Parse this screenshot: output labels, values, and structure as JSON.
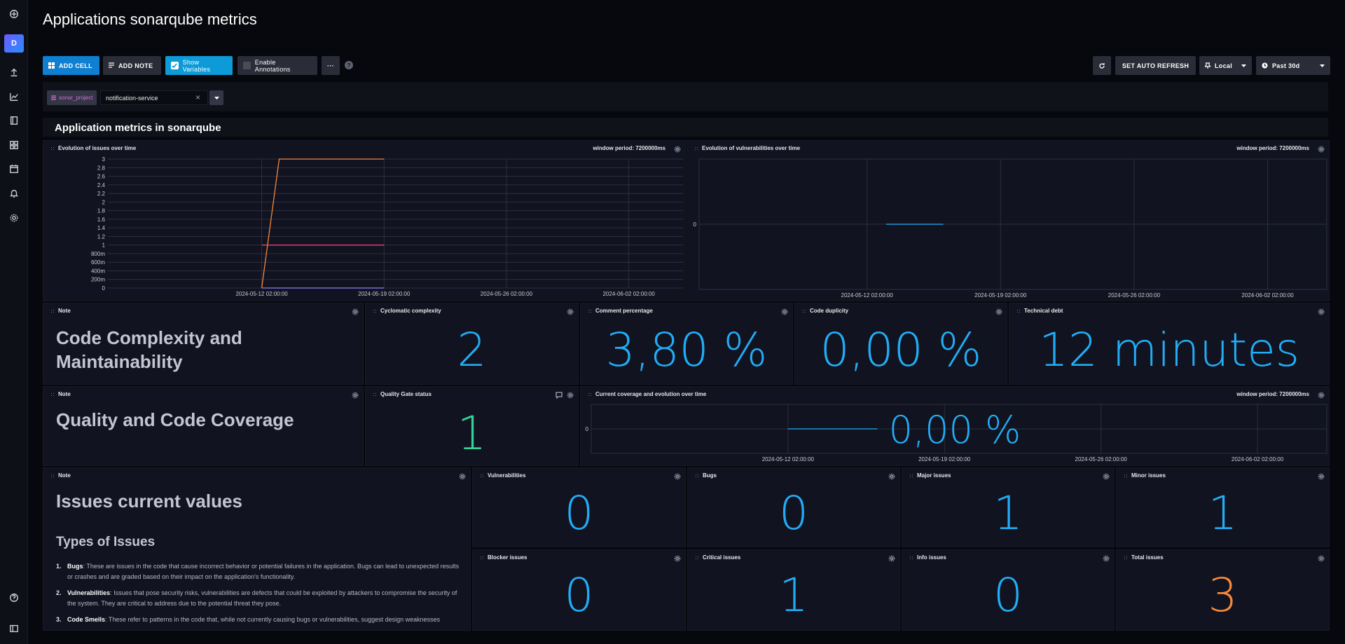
{
  "nav": {
    "avatar": "D",
    "icons": [
      "logo-icon",
      "upload-icon",
      "graph-icon",
      "notebook-icon",
      "dashboards-icon",
      "calendar-icon",
      "bell-icon",
      "gear-icon",
      "help-icon",
      "collapse-icon"
    ]
  },
  "page": {
    "title": "Applications sonarqube metrics"
  },
  "toolbar": {
    "add_cell": "ADD CELL",
    "add_note": "ADD NOTE",
    "show_variables": "Show Variables",
    "enable_annotations": "Enable Annotations",
    "more": "···",
    "help": "?",
    "refresh_icon": "refresh-icon",
    "auto_refresh": "SET AUTO REFRESH",
    "timezone": "Local",
    "time_range": "Past 30d"
  },
  "variables": {
    "name": "sonar_project",
    "value": "notification-service"
  },
  "section": {
    "title": "Application metrics in sonarqube"
  },
  "cells": {
    "issues_graph": {
      "title": "Evolution of issues over time",
      "window": "window period: 7200000ms"
    },
    "vuln_graph": {
      "title": "Evolution of vulnerabilities over time",
      "window": "window period: 7200000ms"
    },
    "note_complexity": {
      "title": "Note",
      "text_1": "Code Complexity and",
      "text_2": "Maintainability"
    },
    "cyclomatic": {
      "title": "Cyclomatic complexity",
      "value": "2"
    },
    "comment": {
      "title": "Comment percentage",
      "value": "3,80 %"
    },
    "duplicity": {
      "title": "Code duplicity",
      "value": "0,00 %"
    },
    "debt": {
      "title": "Technical debt",
      "value": "12 minutes"
    },
    "note_quality": {
      "title": "Note",
      "text": "Quality and Code Coverage"
    },
    "quality_gate": {
      "title": "Quality Gate status",
      "value": "1"
    },
    "coverage": {
      "title": "Current coverage and evolution over time",
      "window": "window period: 7200000ms",
      "value": "0,00 %"
    },
    "note_issues": {
      "title": "Note",
      "heading": "Issues current values",
      "subheading": "Types of Issues",
      "items": [
        {
          "num": "1.",
          "term": "Bugs",
          "text": ": These are issues in the code that cause incorrect behavior or potential failures in the application. Bugs can lead to unexpected results or crashes and are graded based on their impact on the application's functionality."
        },
        {
          "num": "2.",
          "term": "Vulnerabilities",
          "text": ": Issues that pose security risks, vulnerabilities are defects that could be exploited by attackers to compromise the security of the system. They are critical to address due to the potential threat they pose."
        },
        {
          "num": "3.",
          "term": "Code Smells",
          "text": ": These refer to patterns in the code that, while not currently causing bugs or vulnerabilities, suggest design weaknesses"
        }
      ]
    },
    "vulnerabilities": {
      "title": "Vulnerabilities",
      "value": "0"
    },
    "bugs": {
      "title": "Bugs",
      "value": "0"
    },
    "major": {
      "title": "Major issues",
      "value": "1"
    },
    "minor": {
      "title": "Minor issues",
      "value": "1"
    },
    "blocker": {
      "title": "Blocker issues",
      "value": "0"
    },
    "critical": {
      "title": "Critical issues",
      "value": "1"
    },
    "info": {
      "title": "Info issues",
      "value": "0"
    },
    "total": {
      "title": "Total issues",
      "value": "3"
    }
  },
  "colors": {
    "stat": "#22adf6",
    "gate": "#34d399",
    "total": "#f4893a",
    "primary_button": "#0f7fd1",
    "show_variables": "#0d9ad8"
  },
  "chart_data": [
    {
      "type": "line",
      "title": "Evolution of issues over time",
      "x_ticks": [
        "2024-05-12 02:00:00",
        "2024-05-19 02:00:00",
        "2024-05-26 02:00:00",
        "2024-06-02 02:00:00"
      ],
      "y_ticks": [
        "0",
        "200m",
        "400m",
        "600m",
        "800m",
        "1",
        "1.2",
        "1.4",
        "1.6",
        "1.8",
        "2",
        "2.2",
        "2.4",
        "2.6",
        "2.8",
        "3"
      ],
      "ylim": [
        0,
        3
      ],
      "series": [
        {
          "color": "#f4893a",
          "x": [
            "2024-05-12 02:00",
            "2024-05-13 02:00",
            "2024-05-19 02:00"
          ],
          "y": [
            0,
            3,
            3
          ]
        },
        {
          "color": "#e8457a",
          "x": [
            "2024-05-12 02:00",
            "2024-05-19 02:00"
          ],
          "y": [
            1,
            1
          ]
        },
        {
          "color": "#8f7cf7",
          "x": [
            "2024-05-12 02:00",
            "2024-05-19 02:00"
          ],
          "y": [
            0,
            0
          ]
        }
      ]
    },
    {
      "type": "line",
      "title": "Evolution of vulnerabilities over time",
      "x_ticks": [
        "2024-05-12 02:00:00",
        "2024-05-19 02:00:00",
        "2024-05-26 02:00:00",
        "2024-06-02 02:00:00"
      ],
      "y_ticks": [
        "0"
      ],
      "series": [
        {
          "color": "#22adf6",
          "x": [
            "2024-05-13 02:00",
            "2024-05-16 02:00"
          ],
          "y": [
            0,
            0
          ]
        }
      ]
    },
    {
      "type": "line",
      "title": "Current coverage and evolution over time",
      "x_ticks": [
        "2024-05-12 02:00:00",
        "2024-05-19 02:00:00",
        "2024-05-26 02:00:00",
        "2024-06-02 02:00:00"
      ],
      "y_ticks": [
        "0"
      ],
      "series": [
        {
          "color": "#22adf6",
          "x": [
            "2024-05-12 02:00",
            "2024-05-16 02:00"
          ],
          "y": [
            0,
            0
          ]
        }
      ]
    }
  ]
}
